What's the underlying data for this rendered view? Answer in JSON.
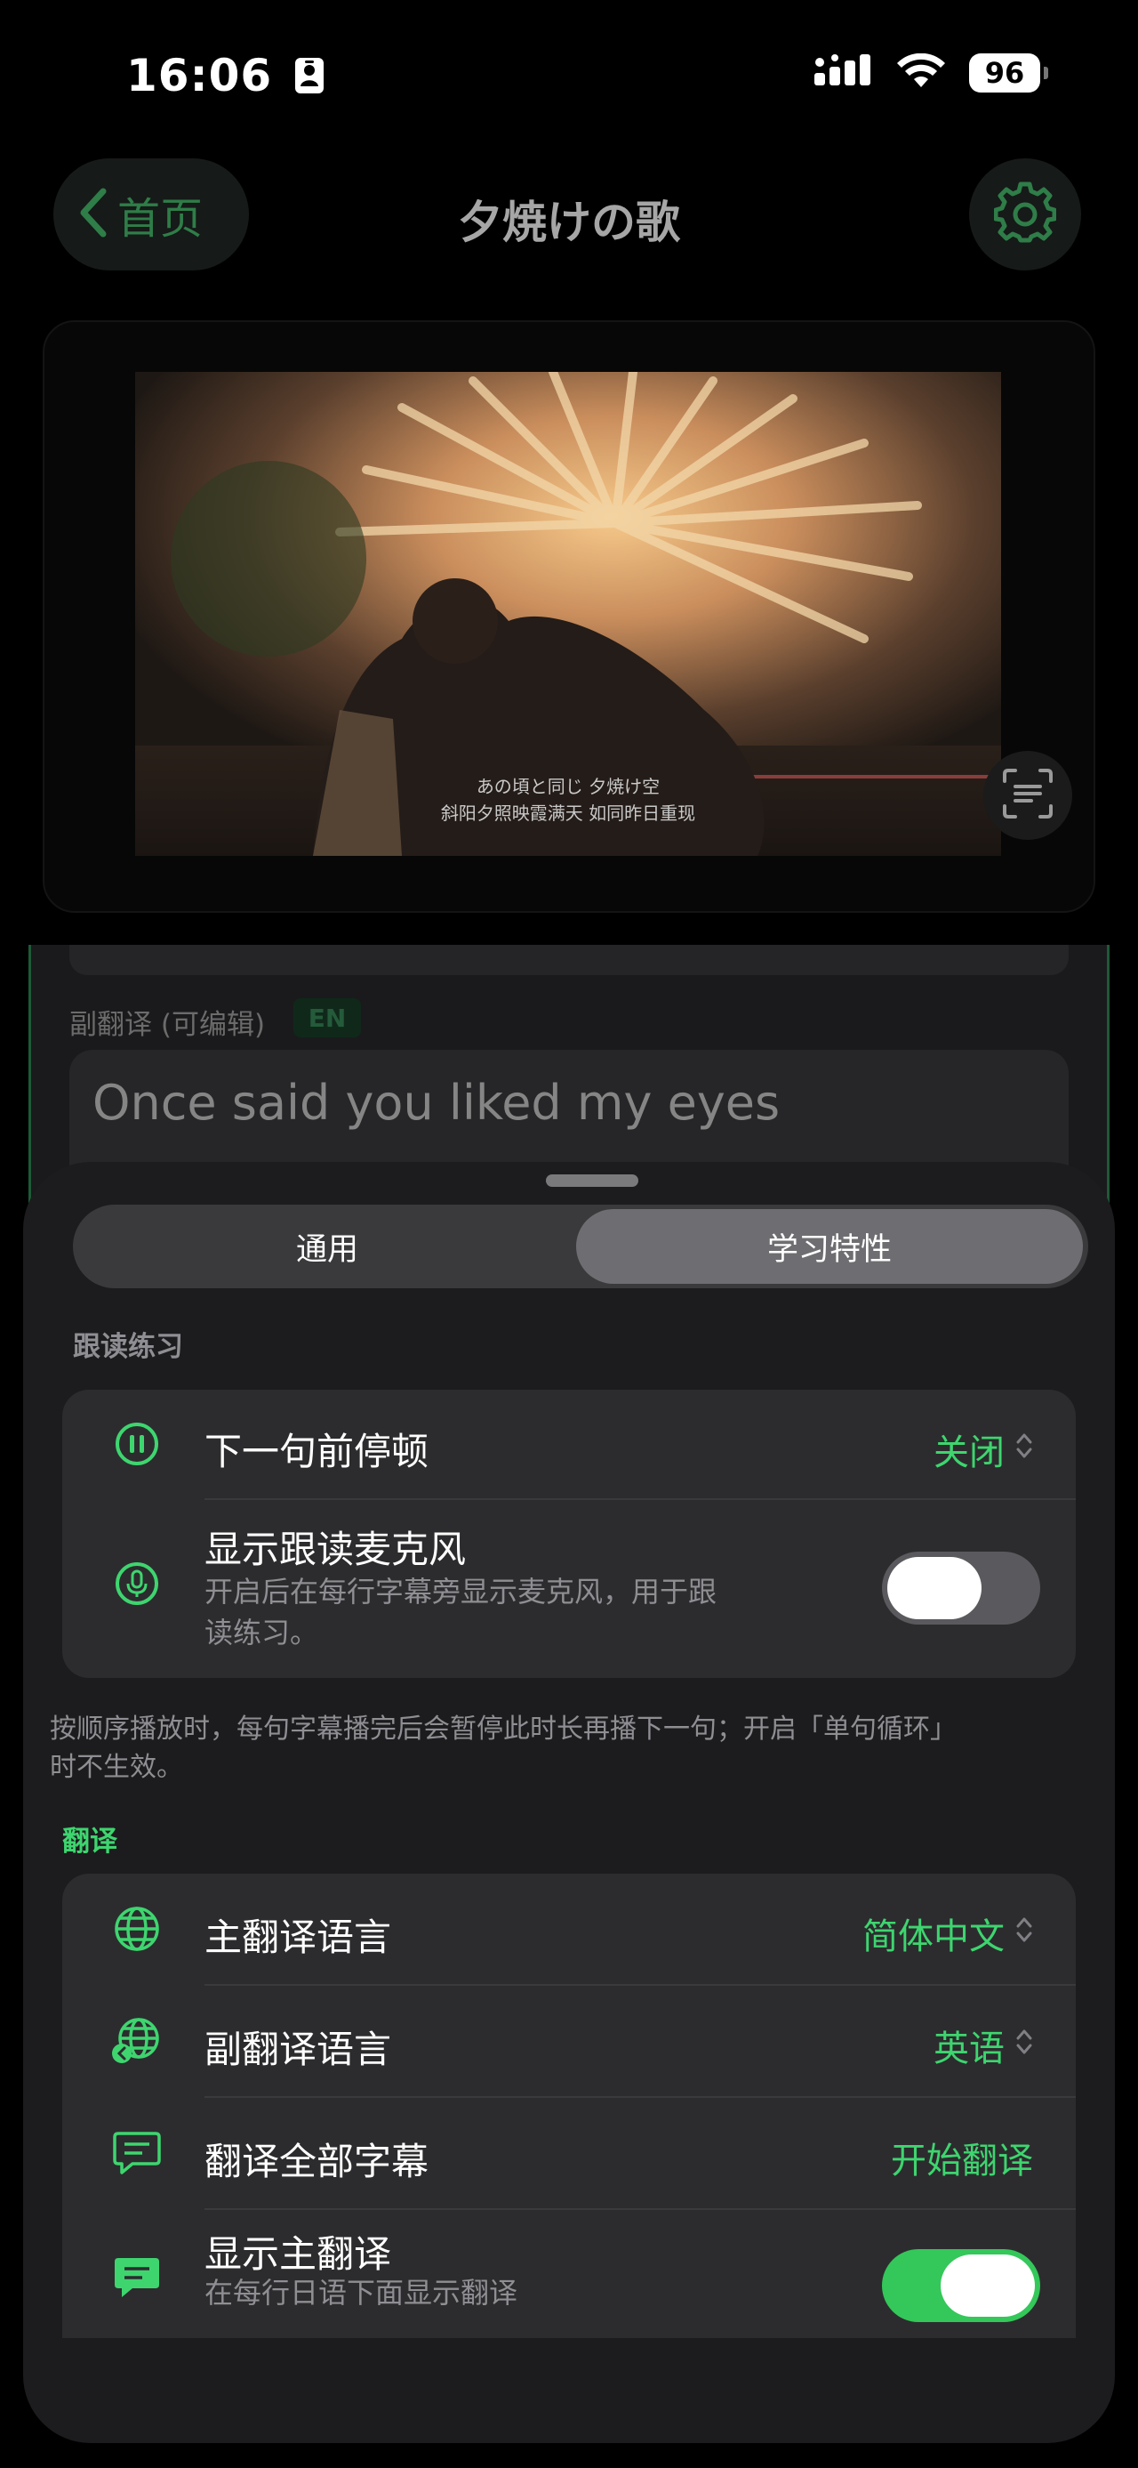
{
  "status_bar": {
    "time": "16:06",
    "battery": "96"
  },
  "nav": {
    "back_label": "首页",
    "title": "夕焼けの歌"
  },
  "video": {
    "subtitle_jp": "あの頃と同じ 夕焼け空",
    "subtitle_cn": "斜阳夕照映霞满天 如同昨日重现"
  },
  "editor": {
    "alt_translation_label": "副翻译 (可编辑)",
    "alt_translation_badge": "EN",
    "alt_translation_text": "Once said you liked my eyes"
  },
  "settings_sheet": {
    "tabs": [
      "通用",
      "学习特性"
    ],
    "selected_tab": "学习特性",
    "shadowing": {
      "header": "跟读练习",
      "pause_label": "下一句前停顿",
      "pause_value": "关闭",
      "mic_title": "显示跟读麦克风",
      "mic_desc": "开启后在每行字幕旁显示麦克风，用于跟读练习。",
      "mic_enabled": false,
      "footnote": "按顺序播放时，每句字幕播完后会暂停此时长再播下一句；开启「单句循环」时不生效。"
    },
    "translation": {
      "header": "翻译",
      "primary_label": "主翻译语言",
      "primary_value": "简体中文",
      "secondary_label": "副翻译语言",
      "secondary_value": "英语",
      "translate_all_label": "翻译全部字幕",
      "translate_all_action": "开始翻译",
      "show_primary_title": "显示主翻译",
      "show_primary_desc": "在每行日语下面显示翻译",
      "show_primary_enabled": true
    }
  },
  "colors": {
    "accent": "#3ed56f",
    "toggle_on": "#34c759",
    "sheet_bg": "#1c1c1e",
    "group_bg": "#2c2c2e"
  },
  "icons": [
    "signal-icon",
    "wifi-icon",
    "battery-icon",
    "chevron-left-icon",
    "gear-icon",
    "scan-text-icon",
    "pause-circle-icon",
    "mic-circle-icon",
    "globe-icon",
    "globe-back-icon",
    "message-icon",
    "message-fill-icon",
    "chevron-updown-icon"
  ]
}
